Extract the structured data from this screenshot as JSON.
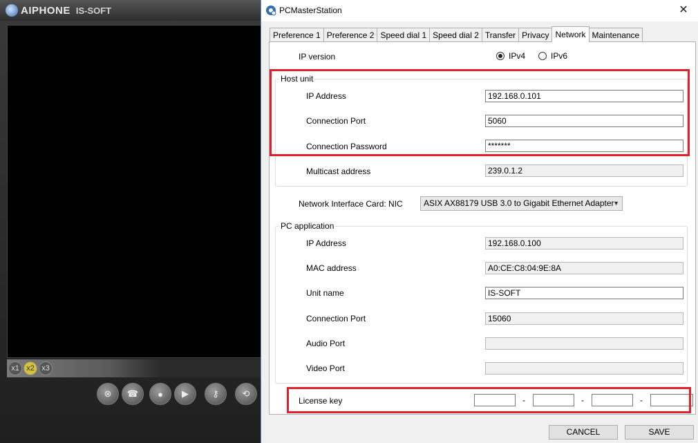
{
  "bg_app": {
    "brand": "AIPHONE",
    "product": "IS-SOFT",
    "zoom": [
      "x1",
      "x2",
      "x3"
    ],
    "zoom_active": "x2"
  },
  "dialog": {
    "title": "PCMasterStation",
    "close": "✕",
    "tabs": [
      "Preference 1",
      "Preference 2",
      "Speed dial 1",
      "Speed dial 2",
      "Transfer",
      "Privacy",
      "Network",
      "Maintenance"
    ],
    "active_tab": "Network"
  },
  "network": {
    "ip_version": {
      "label": "IP version",
      "options": [
        "IPv4",
        "IPv6"
      ],
      "selected": "IPv4"
    },
    "host_unit": {
      "title": "Host unit",
      "ip_address": {
        "label": "IP Address",
        "value": "192.168.0.101"
      },
      "connection_port": {
        "label": "Connection Port",
        "value": "5060"
      },
      "connection_password": {
        "label": "Connection Password",
        "value": "*******"
      },
      "multicast_address": {
        "label": "Multicast address",
        "value": "239.0.1.2"
      }
    },
    "nic": {
      "label": "Network Interface Card: NIC",
      "value": "ASIX AX88179 USB 3.0 to Gigabit Ethernet Adapter"
    },
    "pc_application": {
      "title": "PC application",
      "ip_address": {
        "label": "IP Address",
        "value": "192.168.0.100"
      },
      "mac_address": {
        "label": "MAC address",
        "value": "A0:CE:C8:04:9E:8A"
      },
      "unit_name": {
        "label": "Unit name",
        "value": "IS-SOFT"
      },
      "connection_port": {
        "label": "Connection Port",
        "value": "15060"
      },
      "audio_port": {
        "label": "Audio Port",
        "value": ""
      },
      "video_port": {
        "label": "Video Port",
        "value": ""
      }
    },
    "license_key": {
      "label": "License key",
      "separator": "-"
    }
  },
  "buttons": {
    "cancel": "CANCEL",
    "save": "SAVE"
  },
  "colors": {
    "highlight": "#e0202a"
  }
}
